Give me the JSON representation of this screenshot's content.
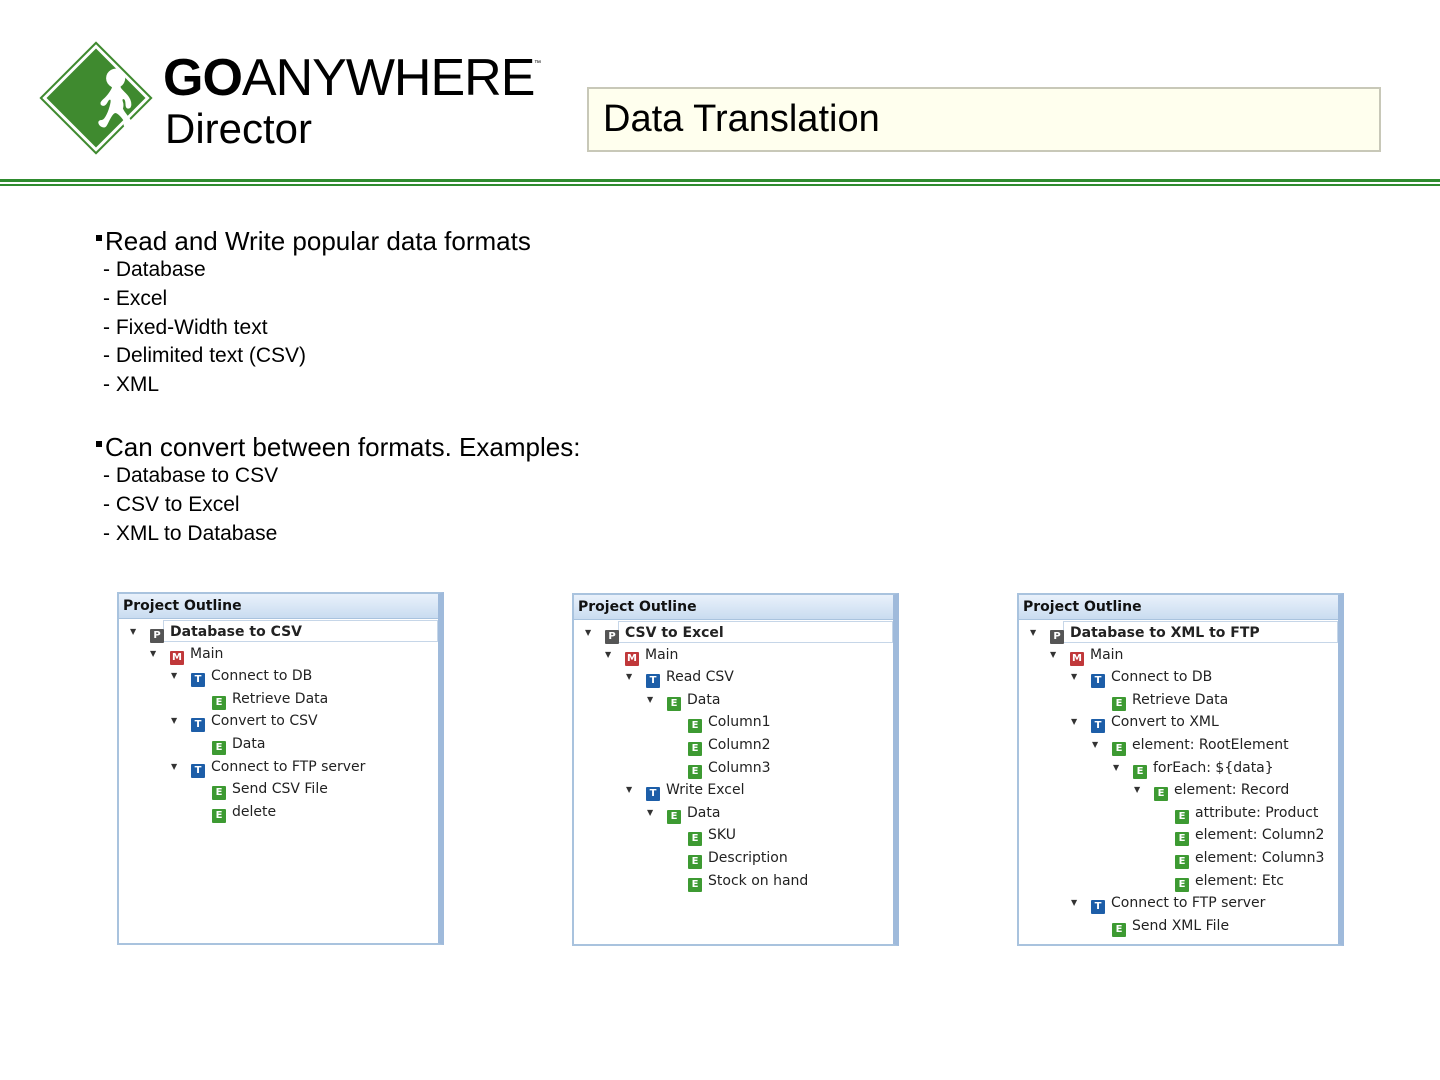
{
  "logo": {
    "brand_bold": "GO",
    "brand_light": "ANYWHERE",
    "tm": "™",
    "product": "Director"
  },
  "title": "Data Translation",
  "bullets": [
    {
      "text": "Read and Write popular data formats",
      "subs": [
        "- Database",
        "- Excel",
        "- Fixed-Width text",
        "- Delimited text (CSV)",
        "- XML"
      ]
    },
    {
      "text": "Can convert between formats.  Examples:",
      "subs": [
        "- Database to CSV",
        "- CSV to Excel",
        "- XML to Database"
      ]
    }
  ],
  "colors": {
    "P": "#555555",
    "M": "#c0383a",
    "T": "#1d5ea8",
    "E": "#3d9a32",
    "accent": "#2e8b2e"
  },
  "panels": [
    {
      "header": "Project Outline",
      "nodes": [
        {
          "label": "Database to CSV",
          "icon": "P",
          "level": 0,
          "toggle": true,
          "selected": true
        },
        {
          "label": "Main",
          "icon": "M",
          "level": 1,
          "toggle": true
        },
        {
          "label": "Connect to DB",
          "icon": "T",
          "level": 2,
          "toggle": true
        },
        {
          "label": "Retrieve Data",
          "icon": "E",
          "level": 3
        },
        {
          "label": "Convert to CSV",
          "icon": "T",
          "level": 2,
          "toggle": true
        },
        {
          "label": "Data",
          "icon": "E",
          "level": 3
        },
        {
          "label": "Connect to FTP server",
          "icon": "T",
          "level": 2,
          "toggle": true
        },
        {
          "label": "Send CSV File",
          "icon": "E",
          "level": 3
        },
        {
          "label": "delete",
          "icon": "E",
          "level": 3
        }
      ]
    },
    {
      "header": "Project Outline",
      "nodes": [
        {
          "label": "CSV to Excel",
          "icon": "P",
          "level": 0,
          "toggle": true,
          "selected": true
        },
        {
          "label": "Main",
          "icon": "M",
          "level": 1,
          "toggle": true
        },
        {
          "label": "Read CSV",
          "icon": "T",
          "level": 2,
          "toggle": true
        },
        {
          "label": "Data",
          "icon": "E",
          "level": 3,
          "toggle": true
        },
        {
          "label": "Column1",
          "icon": "E",
          "level": 4
        },
        {
          "label": "Column2",
          "icon": "E",
          "level": 4
        },
        {
          "label": "Column3",
          "icon": "E",
          "level": 4
        },
        {
          "label": "Write Excel",
          "icon": "T",
          "level": 2,
          "toggle": true
        },
        {
          "label": "Data",
          "icon": "E",
          "level": 3,
          "toggle": true
        },
        {
          "label": "SKU",
          "icon": "E",
          "level": 4
        },
        {
          "label": "Description",
          "icon": "E",
          "level": 4
        },
        {
          "label": "Stock on hand",
          "icon": "E",
          "level": 4
        }
      ]
    },
    {
      "header": "Project Outline",
      "nodes": [
        {
          "label": "Database to XML to FTP",
          "icon": "P",
          "level": 0,
          "toggle": true,
          "selected": true
        },
        {
          "label": "Main",
          "icon": "M",
          "level": 1,
          "toggle": true
        },
        {
          "label": "Connect to DB",
          "icon": "T",
          "level": 2,
          "toggle": true
        },
        {
          "label": "Retrieve Data",
          "icon": "E",
          "level": 3
        },
        {
          "label": "Convert to XML",
          "icon": "T",
          "level": 2,
          "toggle": true
        },
        {
          "label": "element: RootElement",
          "icon": "E",
          "level": 3,
          "toggle": true
        },
        {
          "label": "forEach: ${data}",
          "icon": "E",
          "level": 4,
          "toggle": true
        },
        {
          "label": "element: Record",
          "icon": "E",
          "level": 5,
          "toggle": true
        },
        {
          "label": "attribute: Product",
          "icon": "E",
          "level": 6
        },
        {
          "label": "element: Column2",
          "icon": "E",
          "level": 6
        },
        {
          "label": "element: Column3",
          "icon": "E",
          "level": 6
        },
        {
          "label": "element: Etc",
          "icon": "E",
          "level": 6
        },
        {
          "label": "Connect to FTP server",
          "icon": "T",
          "level": 2,
          "toggle": true
        },
        {
          "label": "Send XML File",
          "icon": "E",
          "level": 3
        }
      ]
    }
  ]
}
